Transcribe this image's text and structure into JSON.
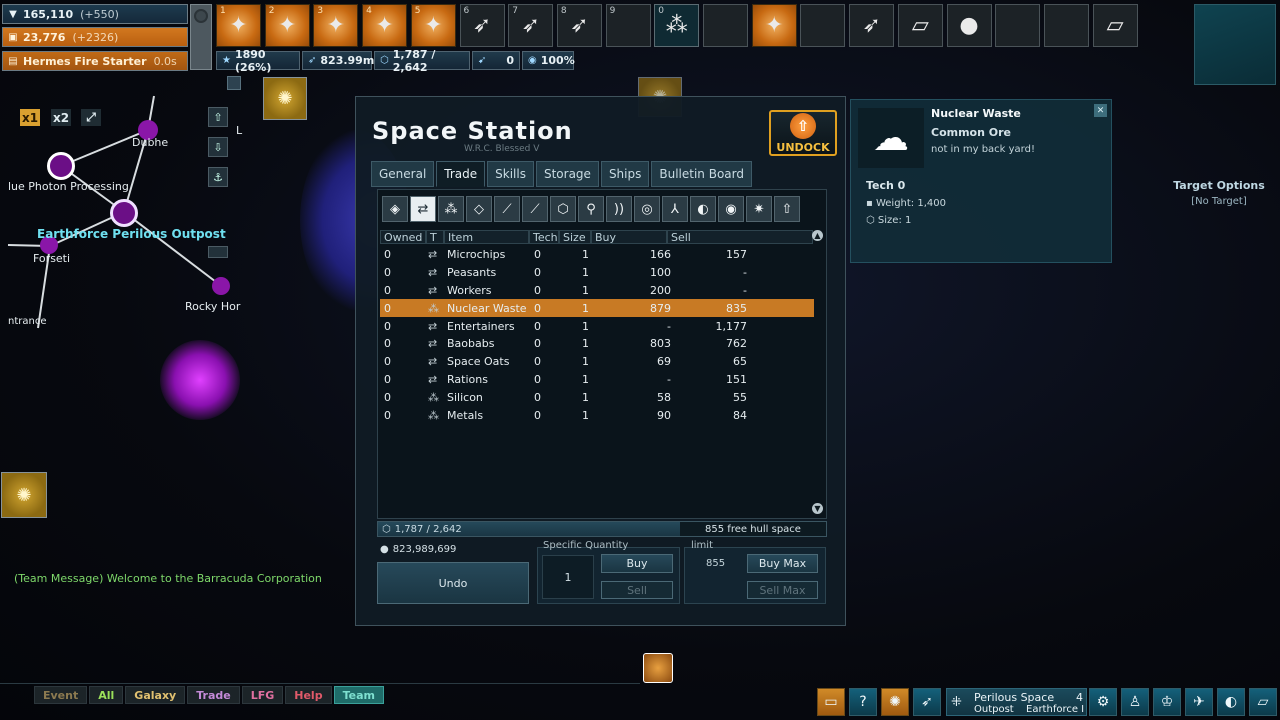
{
  "status": {
    "credits_main": "165,110",
    "credits_main_delta": "(+550)",
    "resource2": "23,776",
    "resource2_delta": "(+2326)",
    "ability_name": "Hermes Fire Starter",
    "ability_time": "0.0s"
  },
  "hotbar": {
    "slots": [
      {
        "num": "1",
        "glyph": "✦",
        "style": "orange"
      },
      {
        "num": "2",
        "glyph": "✦",
        "style": "orange"
      },
      {
        "num": "3",
        "glyph": "✦",
        "style": "orange"
      },
      {
        "num": "4",
        "glyph": "✦",
        "style": "orange"
      },
      {
        "num": "5",
        "glyph": "✦",
        "style": "orange"
      },
      {
        "num": "6",
        "glyph": "➶",
        "style": "dark"
      },
      {
        "num": "7",
        "glyph": "➶",
        "style": "dark"
      },
      {
        "num": "8",
        "glyph": "➶",
        "style": "dark"
      },
      {
        "num": "9",
        "glyph": "",
        "style": "dark"
      },
      {
        "num": "0",
        "glyph": "⁂",
        "style": "teal"
      },
      {
        "num": "",
        "glyph": "",
        "style": "dark"
      },
      {
        "num": "",
        "glyph": "✦",
        "style": "orange"
      },
      {
        "num": "",
        "glyph": "",
        "style": "dark"
      },
      {
        "num": "",
        "glyph": "➶",
        "style": "dark"
      },
      {
        "num": "",
        "glyph": "▱",
        "style": "dark"
      },
      {
        "num": "",
        "glyph": "●",
        "style": "dark"
      },
      {
        "num": "",
        "glyph": "",
        "style": "dark"
      },
      {
        "num": "",
        "glyph": "",
        "style": "dark"
      },
      {
        "num": "",
        "glyph": "▱",
        "style": "dark"
      }
    ]
  },
  "resources": {
    "xp": "1890 (26%)",
    "distance": "823.99m",
    "cargo": "1,787 / 2,642",
    "missiles": "0",
    "shield": "100%"
  },
  "map": {
    "zoom_x1": "x1",
    "zoom_x2": "x2",
    "labels": {
      "dubhe": "Dubhe",
      "photon": "lue Photon Processing",
      "outpost": "Earthforce Perilous Outpost",
      "forseti": "Forseti",
      "rocky": "Rocky Hor",
      "entrance": "ntrance",
      "edge_l": "L"
    }
  },
  "station": {
    "title": "Space Station",
    "subtitle": "W.R.C. Blessed V",
    "undock_label": "UNDOCK",
    "tabs": [
      "General",
      "Trade",
      "Skills",
      "Storage",
      "Ships",
      "Bulletin Board"
    ],
    "active_tab": "Trade",
    "category_icons": [
      "◈",
      "⇄",
      "⁂",
      "◇",
      "⟋",
      "⟋",
      "⬡",
      "⚲",
      "))",
      "◎",
      "⅄",
      "◐",
      "◉",
      "✷",
      "⇧"
    ],
    "columns": {
      "owned": "Owned",
      "t": "T",
      "item": "Item",
      "tech": "Tech",
      "size": "Size",
      "buy": "Buy",
      "sell": "Sell"
    },
    "rows": [
      {
        "owned": "0",
        "t": "⇄",
        "item": "Microchips",
        "tech": "0",
        "size": "1",
        "buy": "166",
        "sell": "157"
      },
      {
        "owned": "0",
        "t": "⇄",
        "item": "Peasants",
        "tech": "0",
        "size": "1",
        "buy": "100",
        "sell": "-"
      },
      {
        "owned": "0",
        "t": "⇄",
        "item": "Workers",
        "tech": "0",
        "size": "1",
        "buy": "200",
        "sell": "-"
      },
      {
        "owned": "0",
        "t": "⁂",
        "item": "Nuclear Waste",
        "tech": "0",
        "size": "1",
        "buy": "879",
        "sell": "835"
      },
      {
        "owned": "0",
        "t": "⇄",
        "item": "Entertainers",
        "tech": "0",
        "size": "1",
        "buy": "-",
        "sell": "1,177"
      },
      {
        "owned": "0",
        "t": "⇄",
        "item": "Baobabs",
        "tech": "0",
        "size": "1",
        "buy": "803",
        "sell": "762"
      },
      {
        "owned": "0",
        "t": "⇄",
        "item": "Space Oats",
        "tech": "0",
        "size": "1",
        "buy": "69",
        "sell": "65"
      },
      {
        "owned": "0",
        "t": "⇄",
        "item": "Rations",
        "tech": "0",
        "size": "1",
        "buy": "-",
        "sell": "151"
      },
      {
        "owned": "0",
        "t": "⁂",
        "item": "Silicon",
        "tech": "0",
        "size": "1",
        "buy": "58",
        "sell": "55"
      },
      {
        "owned": "0",
        "t": "⁂",
        "item": "Metals",
        "tech": "0",
        "size": "1",
        "buy": "90",
        "sell": "84"
      }
    ],
    "selected_row": 3,
    "cargo_text": "1,787 / 2,642",
    "free_space": "855 free hull space",
    "credits": "823,989,699",
    "undo_label": "Undo",
    "specific_quantity_label": "Specific Quantity",
    "quantity_value": "1",
    "buy_label": "Buy",
    "sell_label": "Sell",
    "limit_label": "limit",
    "limit_value": "855",
    "buy_max_label": "Buy Max",
    "sell_max_label": "Sell Max"
  },
  "item_info": {
    "name": "Nuclear Waste",
    "class": "Common Ore",
    "description": "not in my back yard!",
    "tech": "Tech 0",
    "weight": "Weight: 1,400",
    "size": "Size: 1"
  },
  "target": {
    "title": "Target Options",
    "value": "[No Target]"
  },
  "chat": {
    "message": "(Team Message) Welcome to the Barracuda Corporation",
    "tabs": [
      {
        "label": "Event",
        "color": "#8c7a50"
      },
      {
        "label": "All",
        "color": "#9be05a"
      },
      {
        "label": "Galaxy",
        "color": "#e0c070"
      },
      {
        "label": "Trade",
        "color": "#c48ad8"
      },
      {
        "label": "LFG",
        "color": "#e070a0"
      },
      {
        "label": "Help",
        "color": "#e05a6a"
      },
      {
        "label": "Team",
        "color": "#7ee0d0"
      }
    ],
    "active_tab": "Team"
  },
  "location": {
    "name": "Perilous Space",
    "count": "4",
    "type": "Outpost",
    "faction": "Earthforce I"
  },
  "colors": {
    "accent_orange": "#c87a24",
    "panel_teal": "#1f6c69"
  }
}
